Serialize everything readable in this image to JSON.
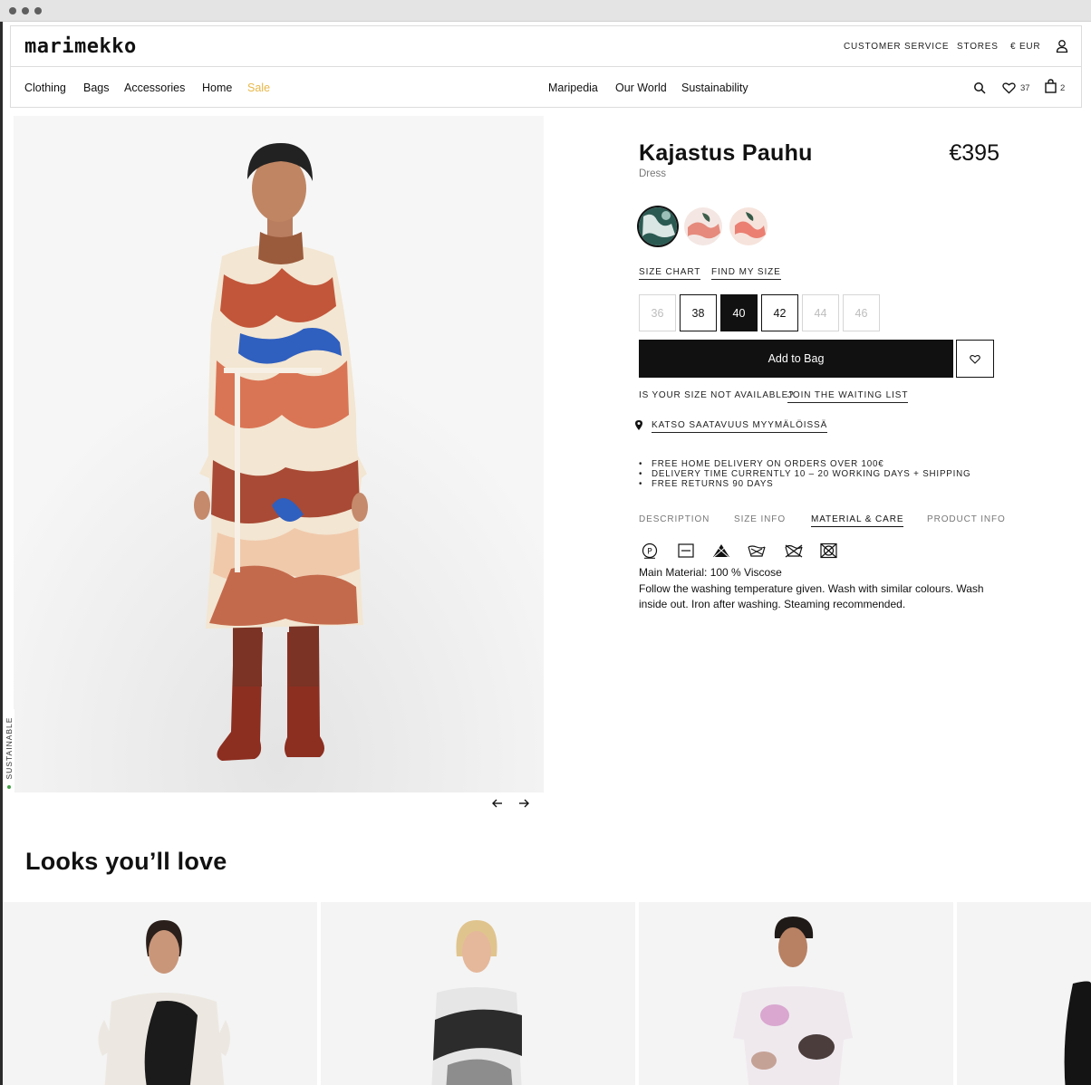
{
  "header": {
    "logo": "marimekko",
    "utility": {
      "customer_service": "CUSTOMER SERVICE",
      "stores": "STORES",
      "currency": "€ EUR"
    },
    "nav_left": [
      "Clothing",
      "Bags",
      "Accessories",
      "Home",
      "Sale"
    ],
    "nav_center": [
      "Maripedia",
      "Our World",
      "Sustainability"
    ],
    "wishlist_count": "37",
    "bag_count": "2"
  },
  "gallery": {
    "badge": "SUSTAINABLE"
  },
  "product": {
    "title": "Kajastus Pauhu",
    "price": "€395",
    "type": "Dress",
    "size_chart": "SIZE CHART",
    "find_my_size": "FIND MY SIZE",
    "sizes": [
      {
        "label": "36",
        "state": "unavailable"
      },
      {
        "label": "38",
        "state": "available"
      },
      {
        "label": "40",
        "state": "selected"
      },
      {
        "label": "42",
        "state": "available"
      },
      {
        "label": "44",
        "state": "unavailable"
      },
      {
        "label": "46",
        "state": "unavailable"
      }
    ],
    "add_to_bag": "Add to Bag",
    "size_not_available": "IS YOUR SIZE NOT AVAILABLE?",
    "join_waiting_list": "JOIN THE WAITING LIST",
    "store_availability": "KATSO SAATAVUUS MYYMÄLÖISSÄ",
    "bullets": [
      "FREE HOME DELIVERY ON ORDERS OVER 100€",
      "DELIVERY TIME CURRENTLY 10 – 20 WORKING DAYS + SHIPPING",
      "FREE RETURNS 90 DAYS"
    ],
    "tabs": [
      "DESCRIPTION",
      "SIZE INFO",
      "MATERIAL & CARE",
      "PRODUCT INFO"
    ],
    "active_tab": "MATERIAL & CARE",
    "care_icons": [
      "dry-clean-p-icon",
      "dry-flat-icon",
      "no-bleach-icon",
      "wash-icon",
      "no-tumble-icon",
      "no-tumble-dry-icon"
    ],
    "main_material": "Main Material: 100 % Viscose",
    "care_instructions": "Follow the washing temperature given. Wash with similar colours. Wash inside out. Iron after washing. Steaming recommended."
  },
  "looks": {
    "title": "Looks you’ll love"
  },
  "colors": {
    "sale": "#e8b84a",
    "black": "#111111"
  }
}
